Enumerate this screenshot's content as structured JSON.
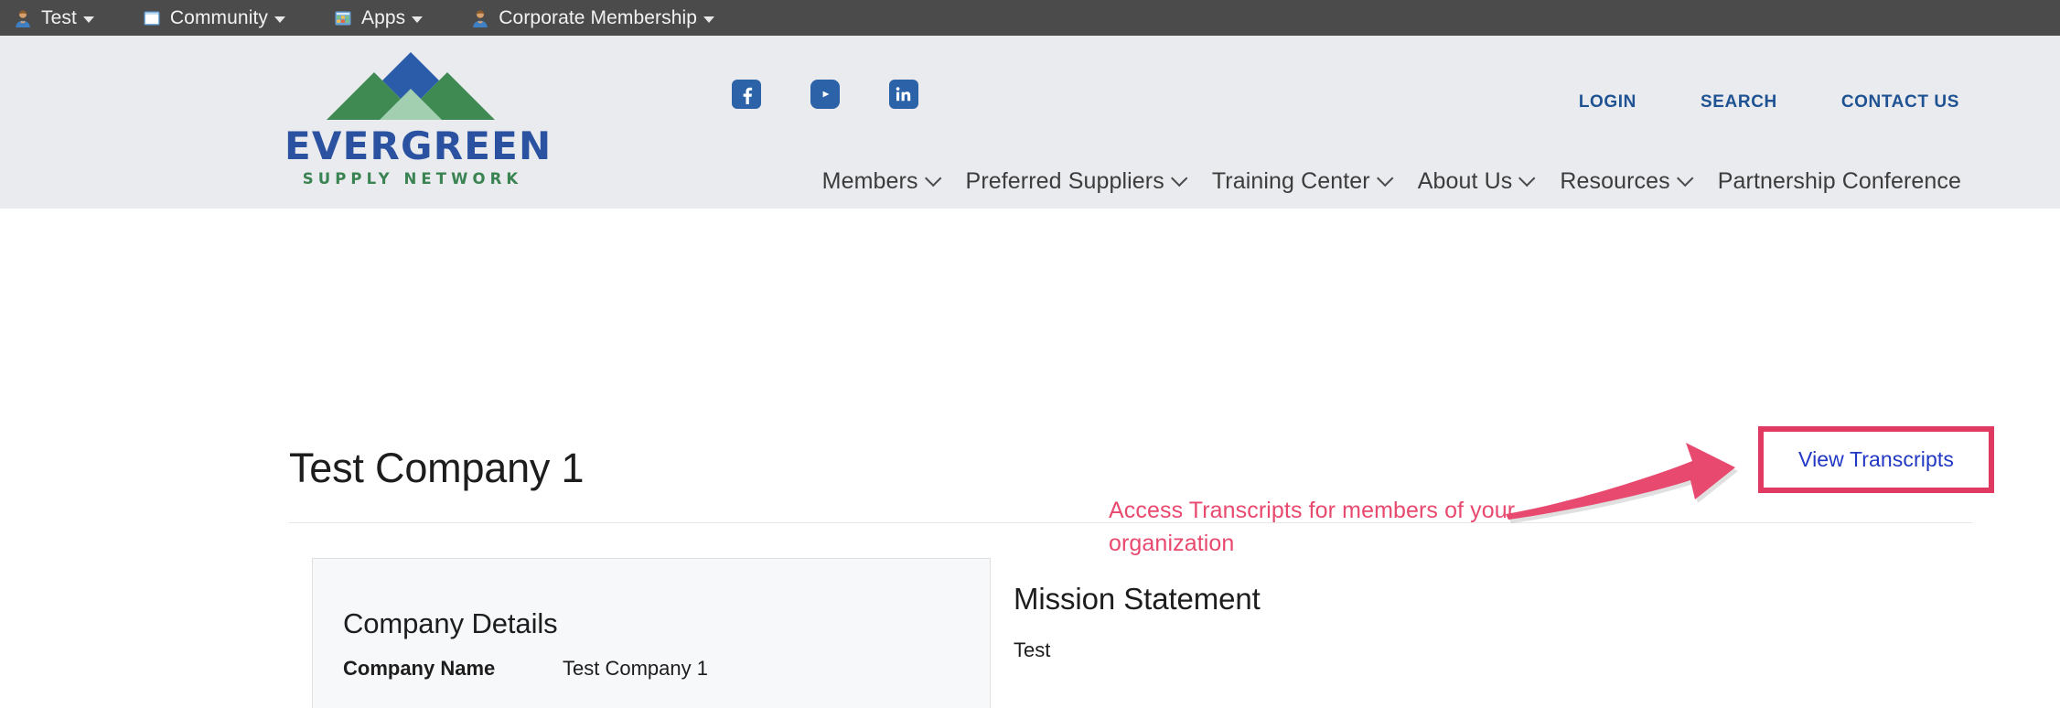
{
  "admin_bar": {
    "items": [
      {
        "label": "Test",
        "icon": "user-avatar-icon",
        "has_caret": true
      },
      {
        "label": "Community",
        "icon": "window-icon",
        "has_caret": true
      },
      {
        "label": "Apps",
        "icon": "app-grid-icon",
        "has_caret": true
      },
      {
        "label": "Corporate Membership",
        "icon": "user-avatar-icon",
        "has_caret": true
      }
    ]
  },
  "header": {
    "logo": {
      "wordmark": "EVERGREEN",
      "tagline": "SUPPLY NETWORK",
      "mark_colors": {
        "diamond_blue": "#2a5caa",
        "peak_green": "#3f8a53",
        "center_green": "#a2cfb0"
      }
    },
    "socials": [
      {
        "name": "facebook-icon",
        "label": "Facebook"
      },
      {
        "name": "youtube-icon",
        "label": "YouTube"
      },
      {
        "name": "linkedin-icon",
        "label": "LinkedIn"
      }
    ],
    "utility_links": [
      {
        "label": "LOGIN"
      },
      {
        "label": "SEARCH"
      },
      {
        "label": "CONTACT US"
      }
    ],
    "nav": [
      {
        "label": "Members",
        "has_chevron": true
      },
      {
        "label": "Preferred Suppliers",
        "has_chevron": true
      },
      {
        "label": "Training Center",
        "has_chevron": true
      },
      {
        "label": "About Us",
        "has_chevron": true
      },
      {
        "label": "Resources",
        "has_chevron": true
      },
      {
        "label": "Partnership Conference",
        "has_chevron": false
      }
    ],
    "background_color": "#eaebef"
  },
  "main": {
    "page_title": "Test Company 1",
    "view_transcripts_label": "View Transcripts",
    "annotation": {
      "text": "Access Transcripts for members of your organization",
      "color": "#e8496e"
    },
    "company_details": {
      "heading": "Company Details",
      "rows": [
        {
          "label": "Company Name",
          "value": "Test Company 1"
        }
      ]
    },
    "mission": {
      "heading": "Mission Statement",
      "body": "Test"
    }
  }
}
